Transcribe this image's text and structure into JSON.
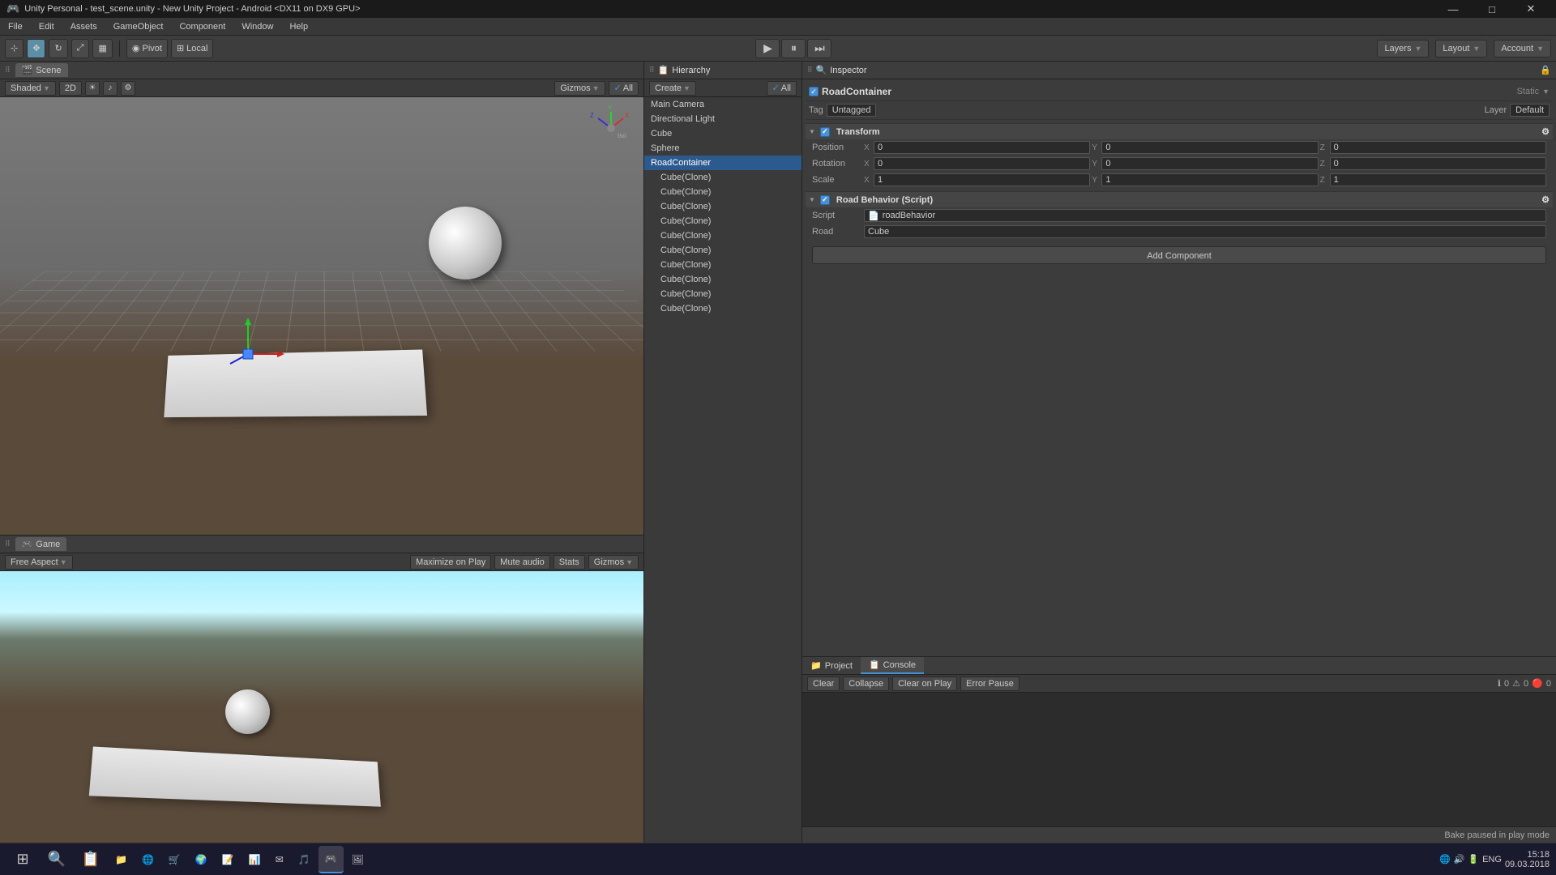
{
  "window": {
    "title": "Unity Personal - test_scene.unity - New Unity Project - Android <DX11 on DX9 GPU>",
    "icon": "🎮"
  },
  "win_controls": {
    "minimize": "—",
    "maximize": "□",
    "close": "✕"
  },
  "menu": {
    "items": [
      "File",
      "Edit",
      "Assets",
      "GameObject",
      "Component",
      "Window",
      "Help"
    ]
  },
  "toolbar": {
    "transform_tools": [
      "⊹",
      "✥",
      "↻",
      "⤢",
      "▦"
    ],
    "pivot_label": "Pivot",
    "local_label": "Local",
    "play": "▶",
    "pause": "⏸",
    "step": "⏭",
    "layers_label": "Layers",
    "layout_label": "Layout",
    "account_label": "Account"
  },
  "scene_panel": {
    "tab_label": "Scene",
    "icon": "🎬",
    "shaded_label": "Shaded",
    "two_d_label": "2D",
    "gizmos_label": "Gizmos",
    "all_label": "All"
  },
  "game_panel": {
    "tab_label": "Game",
    "icon": "🎮",
    "free_aspect_label": "Free Aspect",
    "maximize_label": "Maximize on Play",
    "mute_label": "Mute audio",
    "stats_label": "Stats",
    "gizmos_label": "Gizmos"
  },
  "hierarchy": {
    "tab_label": "Hierarchy",
    "create_label": "Create",
    "all_label": "All",
    "items": [
      {
        "name": "Main Camera",
        "selected": false,
        "indent": 0
      },
      {
        "name": "Directional Light",
        "selected": false,
        "indent": 0
      },
      {
        "name": "Cube",
        "selected": false,
        "indent": 0
      },
      {
        "name": "Sphere",
        "selected": false,
        "indent": 0
      },
      {
        "name": "RoadContainer",
        "selected": true,
        "indent": 0
      },
      {
        "name": "Cube(Clone)",
        "selected": false,
        "indent": 1
      },
      {
        "name": "Cube(Clone)",
        "selected": false,
        "indent": 1
      },
      {
        "name": "Cube(Clone)",
        "selected": false,
        "indent": 1
      },
      {
        "name": "Cube(Clone)",
        "selected": false,
        "indent": 1
      },
      {
        "name": "Cube(Clone)",
        "selected": false,
        "indent": 1
      },
      {
        "name": "Cube(Clone)",
        "selected": false,
        "indent": 1
      },
      {
        "name": "Cube(Clone)",
        "selected": false,
        "indent": 1
      },
      {
        "name": "Cube(Clone)",
        "selected": false,
        "indent": 1
      },
      {
        "name": "Cube(Clone)",
        "selected": false,
        "indent": 1
      },
      {
        "name": "Cube(Clone)",
        "selected": false,
        "indent": 1
      }
    ]
  },
  "inspector": {
    "tab_label": "Inspector",
    "object_name": "RoadContainer",
    "tag_label": "Tag",
    "tag_value": "Untagged",
    "layer_label": "Layer",
    "layer_value": "Default",
    "static_label": "Static",
    "transform": {
      "header": "Transform",
      "position": {
        "label": "Position",
        "x": "0",
        "y": "0",
        "z": "0"
      },
      "rotation": {
        "label": "Rotation",
        "x": "0",
        "y": "0",
        "z": "0"
      },
      "scale": {
        "label": "Scale",
        "x": "1",
        "y": "1",
        "z": "1"
      }
    },
    "road_behavior": {
      "header": "Road Behavior (Script)",
      "script_label": "Script",
      "script_value": "roadBehavior",
      "road_label": "Road",
      "road_value": "Cube"
    },
    "add_component": "Add Component"
  },
  "console": {
    "project_tab": "Project",
    "console_tab": "Console",
    "clear_label": "Clear",
    "collapse_label": "Collapse",
    "clear_on_play_label": "Clear on Play",
    "error_pause_label": "Error Pause",
    "info_count": "0",
    "warn_count": "0",
    "error_count": "0"
  },
  "status_bar": {
    "message": "Bake paused in play mode"
  },
  "taskbar": {
    "apps": [
      "⊞",
      "🔍",
      "📁",
      "🌐",
      "📁",
      "🌍",
      "📝",
      "📊",
      "✉",
      "🎵",
      "🎮",
      "🖼"
    ],
    "time": "15:18",
    "date": "09.03.2018",
    "language": "ENG"
  }
}
